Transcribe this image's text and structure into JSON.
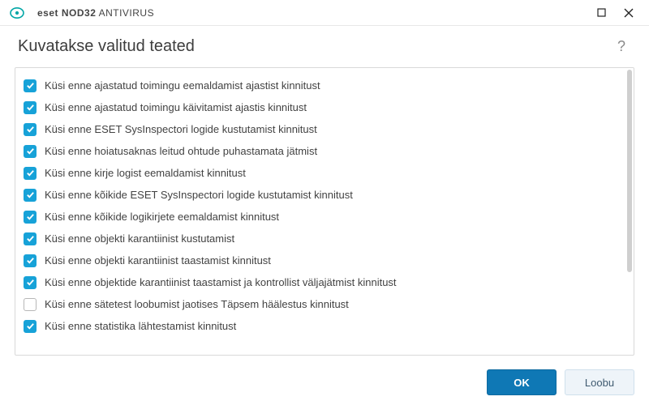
{
  "brand": {
    "eset": "eset",
    "prod_bold": "NOD32",
    "prod_rest": "ANTIVIRUS"
  },
  "header": {
    "title": "Kuvatakse valitud teated",
    "help": "?"
  },
  "items": [
    {
      "label": "Küsi enne ajastatud toimingu eemaldamist ajastist kinnitust",
      "checked": true
    },
    {
      "label": "Küsi enne ajastatud toimingu käivitamist ajastis kinnitust",
      "checked": true
    },
    {
      "label": "Küsi enne ESET SysInspectori logide kustutamist kinnitust",
      "checked": true
    },
    {
      "label": "Küsi enne hoiatusaknas leitud ohtude puhastamata jätmist",
      "checked": true
    },
    {
      "label": "Küsi enne kirje logist eemaldamist kinnitust",
      "checked": true
    },
    {
      "label": "Küsi enne kõikide ESET SysInspectori logide kustutamist kinnitust",
      "checked": true
    },
    {
      "label": "Küsi enne kõikide logikirjete eemaldamist kinnitust",
      "checked": true
    },
    {
      "label": "Küsi enne objekti karantiinist kustutamist",
      "checked": true
    },
    {
      "label": "Küsi enne objekti karantiinist taastamist kinnitust",
      "checked": true
    },
    {
      "label": "Küsi enne objektide karantiinist taastamist ja kontrollist väljajätmist kinnitust",
      "checked": true
    },
    {
      "label": "Küsi enne sätetest loobumist jaotises Täpsem häälestus kinnitust",
      "checked": false
    },
    {
      "label": "Küsi enne statistika lähtestamist kinnitust",
      "checked": true
    }
  ],
  "footer": {
    "ok": "OK",
    "cancel": "Loobu"
  }
}
